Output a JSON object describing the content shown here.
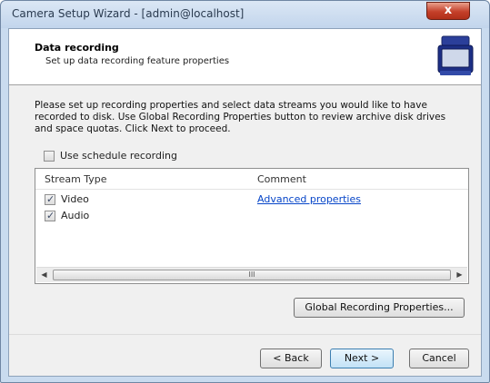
{
  "window": {
    "title": "Camera Setup Wizard - [admin@localhost]",
    "close_glyph": "x"
  },
  "header": {
    "title": "Data recording",
    "subtitle": "Set up data recording feature properties",
    "icon": "recorder-case-icon"
  },
  "description": "Please set up recording properties and select data streams you would like to have recorded to disk. Use Global Recording Properties button to review archive disk drives and space quotas. Click Next to proceed.",
  "schedule": {
    "label": "Use schedule recording",
    "checked": false
  },
  "list": {
    "columns": [
      "Stream Type",
      "Comment"
    ],
    "rows": [
      {
        "label": "Video",
        "checked": true,
        "comment": "Advanced properties"
      },
      {
        "label": "Audio",
        "checked": true,
        "comment": ""
      }
    ],
    "scroll_thumb_glyph": "III"
  },
  "buttons": {
    "global": "Global Recording Properties...",
    "back": "< Back",
    "next": "Next >",
    "cancel": "Cancel"
  },
  "colors": {
    "link": "#0645c8",
    "close": "#c4402a",
    "frame": "#c9dbef"
  }
}
